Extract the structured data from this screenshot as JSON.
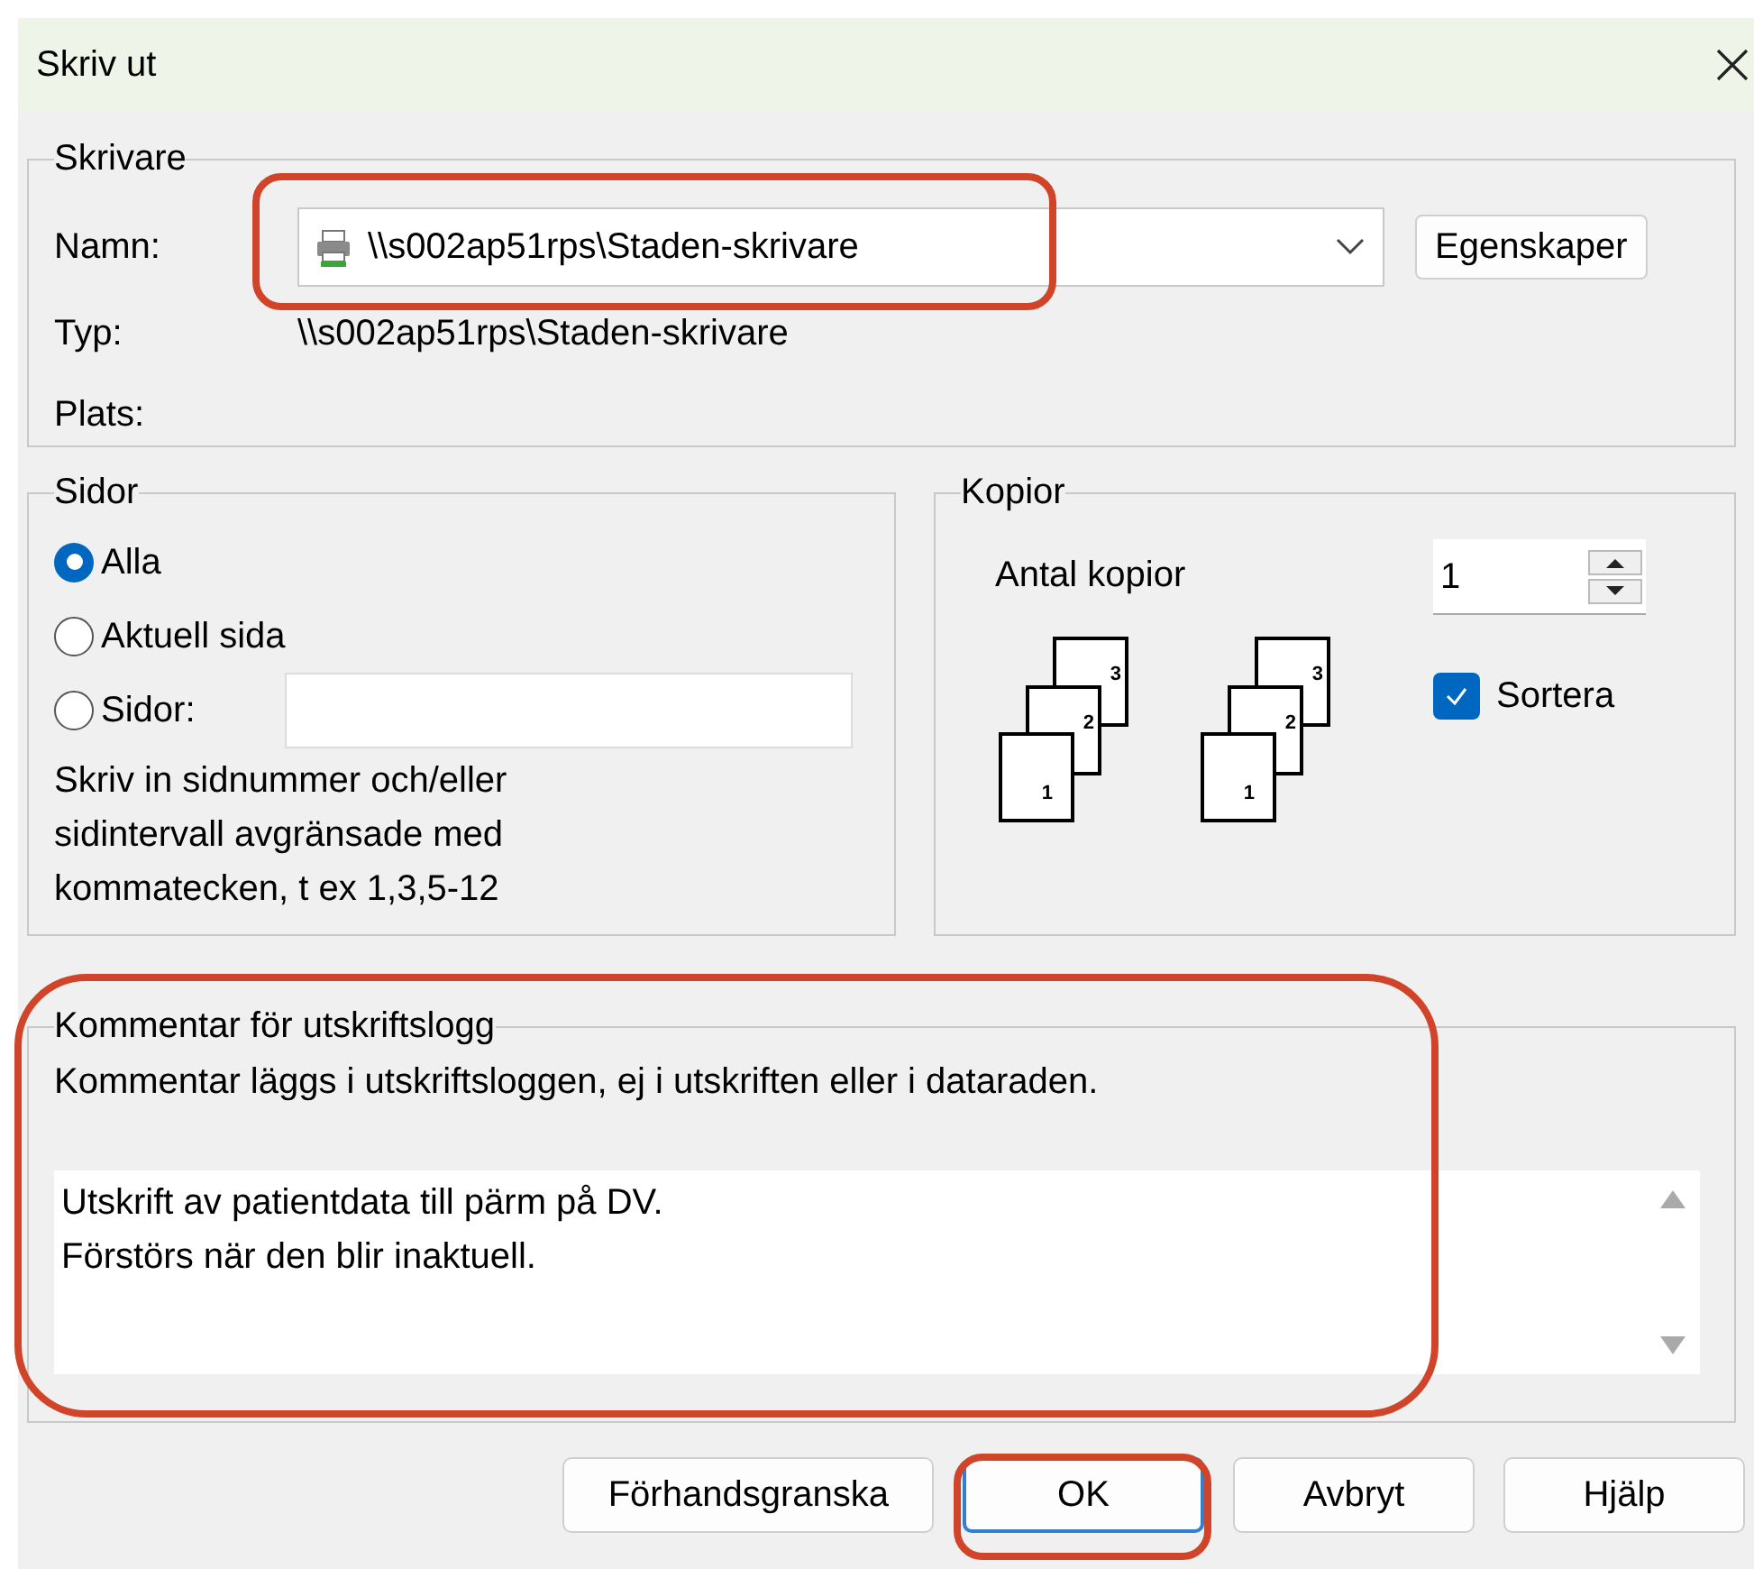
{
  "window": {
    "title": "Skriv ut"
  },
  "printer": {
    "legend": "Skrivare",
    "name_label": "Namn:",
    "name_value": "\\\\s002ap51rps\\Staden-skrivare",
    "highlighted": true,
    "properties_button": "Egenskaper",
    "type_label": "Typ:",
    "type_value": "\\\\s002ap51rps\\Staden-skrivare",
    "location_label": "Plats:"
  },
  "pages": {
    "legend": "Sidor",
    "options": [
      {
        "label": "Alla",
        "selected": true
      },
      {
        "label": "Aktuell sida",
        "selected": false
      },
      {
        "label": "Sidor:",
        "selected": false
      }
    ],
    "range_hint_lines": [
      "Skriv in sidnummer och/eller",
      "sidintervall avgränsade med",
      "kommatecken, t ex 1,3,5-12"
    ]
  },
  "copies": {
    "legend": "Kopior",
    "count_label": "Antal kopior",
    "count_value": "1",
    "collate": {
      "label": "Sortera",
      "checked": true
    },
    "stacks": [
      [
        "1",
        "2",
        "3"
      ],
      [
        "1",
        "2",
        "3"
      ]
    ]
  },
  "comment": {
    "legend": "Kommentar för utskriftslogg",
    "description": "Kommentar läggs i utskriftsloggen, ej i utskriften eller i dataraden.",
    "value_lines": [
      "Utskrift av patientdata till pärm på DV.",
      "Förstörs när den blir inaktuell."
    ],
    "highlighted": true
  },
  "buttons": [
    {
      "label": "Förhandsgranska",
      "default": false,
      "highlighted": false
    },
    {
      "label": "OK",
      "default": true,
      "highlighted": true
    },
    {
      "label": "Avbryt",
      "default": false,
      "highlighted": false
    },
    {
      "label": "Hjälp",
      "default": false,
      "highlighted": false
    }
  ]
}
